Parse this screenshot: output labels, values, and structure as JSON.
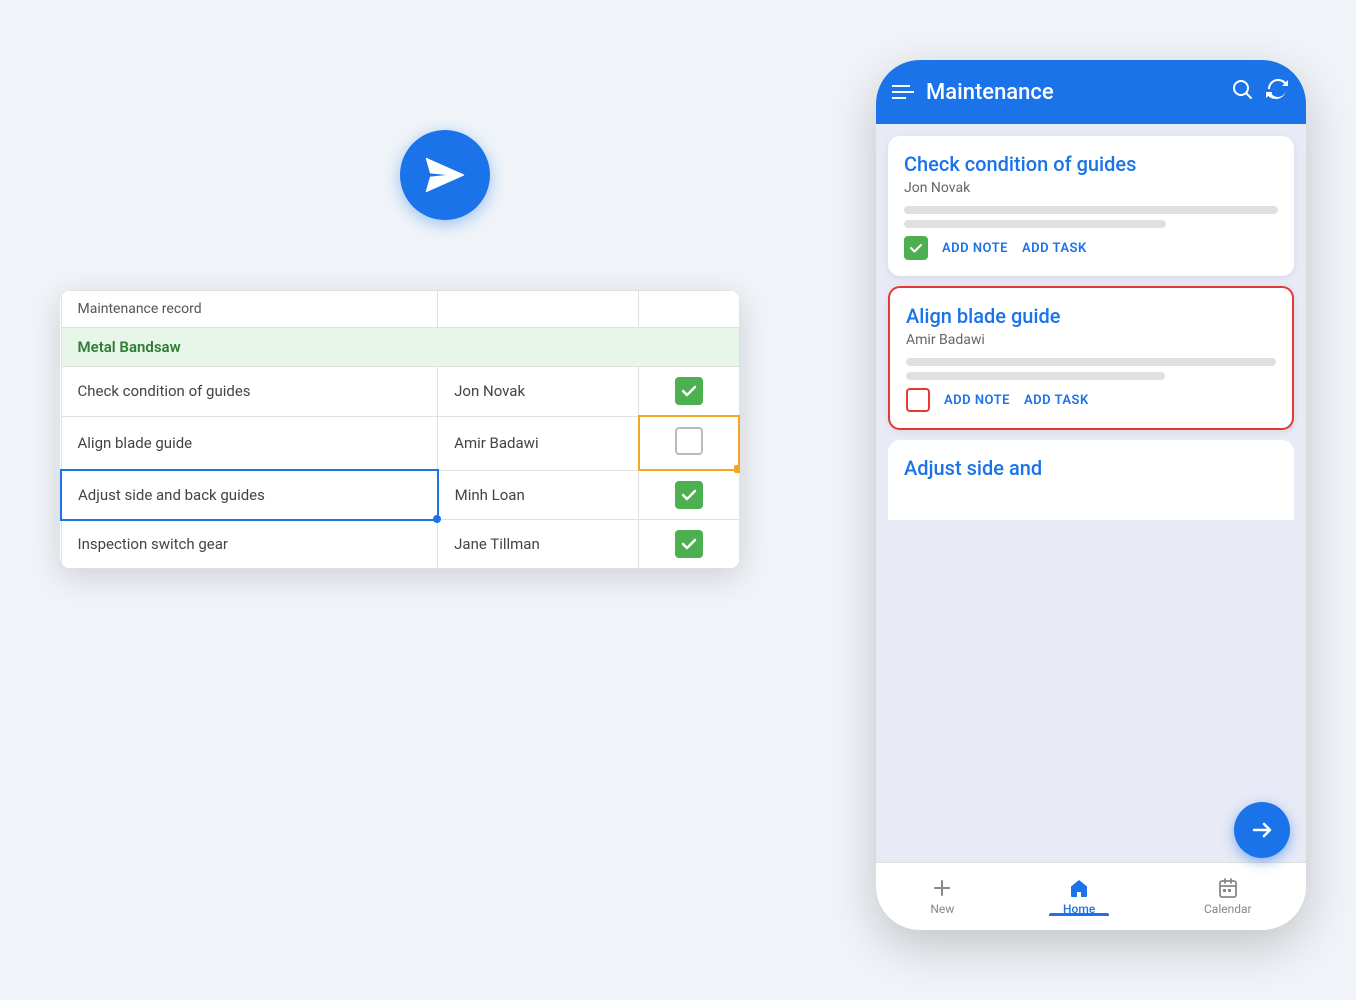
{
  "spreadsheet": {
    "header_row": {
      "col1": "Maintenance record",
      "col2": "",
      "col3": ""
    },
    "group_label": "Metal Bandsaw",
    "rows": [
      {
        "task": "Check condition of guides",
        "person": "Jon Novak",
        "checked": true,
        "selected": false,
        "cell_highlighted": false
      },
      {
        "task": "Align blade guide",
        "person": "Amir Badawi",
        "checked": false,
        "selected": false,
        "cell_highlighted": true
      },
      {
        "task": "Adjust side and back guides",
        "person": "Minh Loan",
        "checked": true,
        "selected": true,
        "cell_highlighted": false
      },
      {
        "task": "Inspection switch gear",
        "person": "Jane Tillman",
        "checked": true,
        "selected": false,
        "cell_highlighted": false
      }
    ]
  },
  "phone": {
    "app_bar": {
      "title": "Maintenance"
    },
    "cards": [
      {
        "id": "card1",
        "title": "Check condition of guides",
        "person": "Jon Novak",
        "checked": true,
        "selected": false,
        "actions": {
          "add_note": "ADD NOTE",
          "add_task": "ADD TASK"
        }
      },
      {
        "id": "card2",
        "title": "Align blade guide",
        "person": "Amir Badawi",
        "checked": false,
        "selected": true,
        "actions": {
          "add_note": "ADD NOTE",
          "add_task": "ADD TASK"
        }
      },
      {
        "id": "card3",
        "title": "Adjust side and",
        "person": "",
        "partial": true
      }
    ],
    "bottom_nav": {
      "items": [
        {
          "label": "New",
          "icon": "plus",
          "active": false
        },
        {
          "label": "Home",
          "icon": "home",
          "active": true
        },
        {
          "label": "Calendar",
          "icon": "calendar",
          "active": false
        }
      ]
    }
  },
  "fab": {
    "icon": "export-arrow"
  }
}
